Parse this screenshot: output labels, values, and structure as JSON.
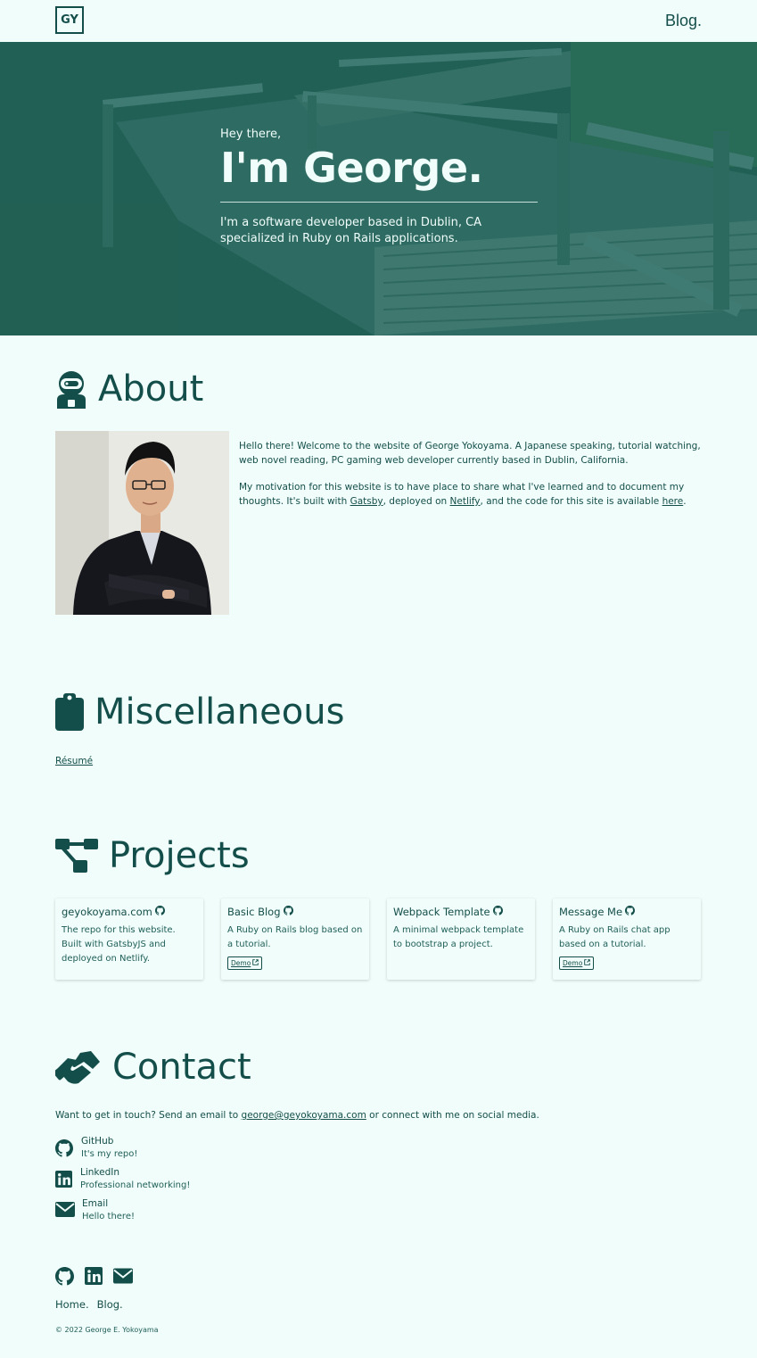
{
  "nav": {
    "logo": "GY",
    "blog": "Blog."
  },
  "hero": {
    "greeting": "Hey there,",
    "name": "I'm George.",
    "description": "I'm a software developer based in Dublin, CA specialized in Ruby on Rails applications."
  },
  "about": {
    "title": "About",
    "p1": "Hello there! Welcome to the website of George Yokoyama. A Japanese speaking, tutorial watching, web novel reading, PC gaming web developer currently based in Dublin, California.",
    "p2_a": "My motivation for this website is to have place to share what I've learned and to document my thoughts. It's built with ",
    "gatsby": "Gatsby",
    "p2_b": ", deployed on ",
    "netlify": "Netlify",
    "p2_c": ", and the code for this site is available ",
    "here": "here",
    "p2_d": "."
  },
  "misc": {
    "title": "Miscellaneous",
    "resume": "Résumé"
  },
  "projects": {
    "title": "Projects",
    "items": [
      {
        "name": "geyokoyama.com",
        "desc": "The repo for this website. Built with GatsbyJS and deployed on Netlify.",
        "demo": ""
      },
      {
        "name": "Basic Blog",
        "desc": "A Ruby on Rails blog based on a tutorial.",
        "demo": "Demo"
      },
      {
        "name": "Webpack Template",
        "desc": "A minimal webpack template to bootstrap a project.",
        "demo": ""
      },
      {
        "name": "Message Me",
        "desc": "A Ruby on Rails chat app based on a tutorial.",
        "demo": "Demo"
      }
    ]
  },
  "contact": {
    "title": "Contact",
    "intro_a": "Want to get in touch? Send an email to ",
    "email": "george@geyokoyama.com",
    "intro_b": " or connect with me on social media.",
    "items": [
      {
        "label": "GitHub",
        "sub": "It's my repo!",
        "icon": "github-icon"
      },
      {
        "label": "LinkedIn",
        "sub": "Professional networking!",
        "icon": "linkedin-icon"
      },
      {
        "label": "Email",
        "sub": "Hello there!",
        "icon": "envelope-icon"
      }
    ]
  },
  "footer": {
    "home": "Home.",
    "blog": "Blog.",
    "copyright": "© 2022 George E. Yokoyama"
  },
  "colors": {
    "primary": "#134e4a",
    "background": "#f0fdfa"
  }
}
